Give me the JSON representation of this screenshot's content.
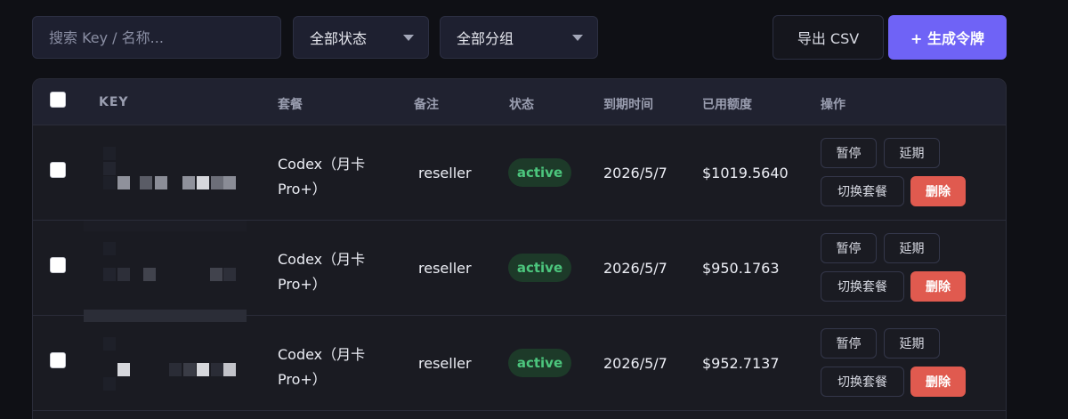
{
  "toolbar": {
    "search_placeholder": "搜索 Key / 名称...",
    "status_filter": "全部状态",
    "group_filter": "全部分组",
    "export_label": "导出 CSV",
    "create_label": "+ 生成令牌"
  },
  "table": {
    "headers": [
      "KEY",
      "套餐",
      "备注",
      "状态",
      "到期时间",
      "已用额度",
      "操作"
    ],
    "rows": [
      {
        "key": "",
        "plan": "Codex（月卡 Pro+）",
        "note": "reseller",
        "status": "active",
        "expiry": "2026/5/7",
        "used": "$1019.5640"
      },
      {
        "key": "",
        "plan": "Codex（月卡 Pro+）",
        "note": "reseller",
        "status": "active",
        "expiry": "2026/5/7",
        "used": "$950.1763"
      },
      {
        "key": "",
        "plan": "Codex（月卡 Pro+）",
        "note": "reseller",
        "status": "active",
        "expiry": "2026/5/7",
        "used": "$952.7137"
      }
    ],
    "actions": {
      "pause": "暂停",
      "extend": "延期",
      "switch": "切换套餐",
      "delete": "删除"
    }
  },
  "colors": {
    "background": "#0f1015",
    "accent": "#6f63f6",
    "active_badge": "#4cc67d",
    "delete": "#e05a4f"
  }
}
